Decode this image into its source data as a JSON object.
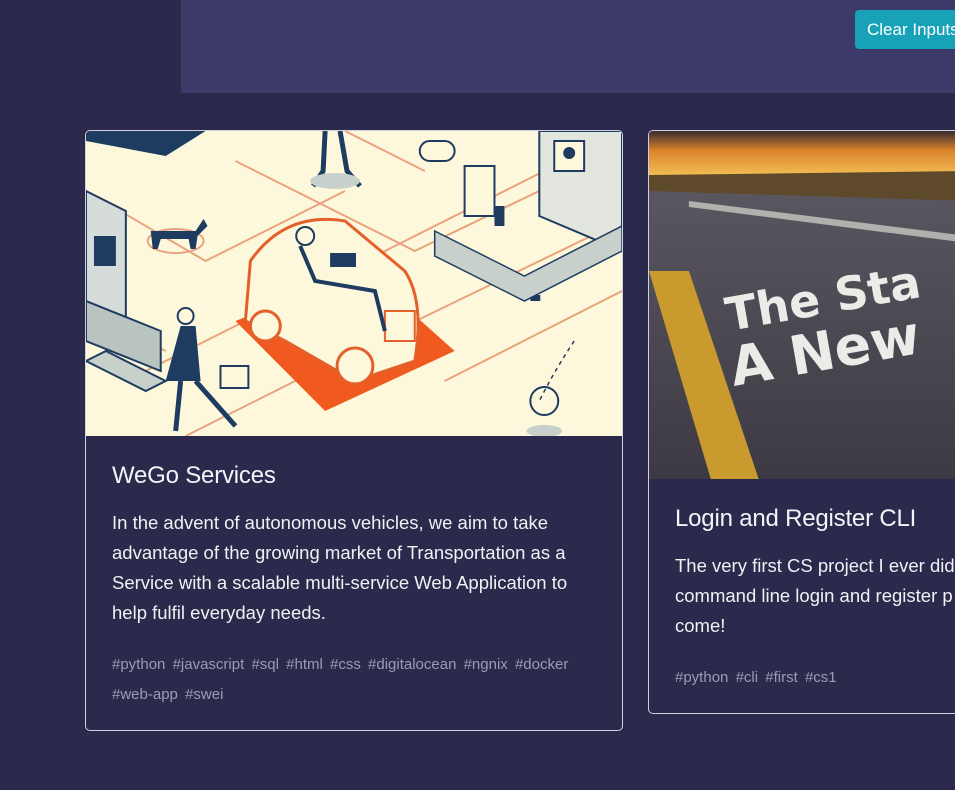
{
  "header": {
    "clear_button_label": "Clear Inputs"
  },
  "colors": {
    "background": "#2b2a4c",
    "header_bar": "#3b3a69",
    "accent_button": "#17a2b8",
    "tag_text": "#9b9bb3"
  },
  "projects": [
    {
      "title": "WeGo Services",
      "description": "In the advent of autonomous vehicles, we aim to take advantage of the growing market of Transportation as a Service with a scalable multi-service Web Application to help fulfil everyday needs.",
      "tags": [
        "#python",
        "#javascript",
        "#sql",
        "#html",
        "#css",
        "#digitalocean",
        "#ngnix",
        "#docker",
        "#web-app",
        "#swei"
      ],
      "image": "isometric-city-autonomous-car-illustration"
    },
    {
      "title": "Login and Register CLI",
      "description_lines": [
        "The very first CS project I ever did",
        "command line login and register p",
        "come!"
      ],
      "tags": [
        "#python",
        "#cli",
        "#first",
        "#cs1"
      ],
      "image": "road-sunset-the-start-a-new",
      "image_text_lines": [
        "The Sta",
        "A New"
      ]
    }
  ]
}
